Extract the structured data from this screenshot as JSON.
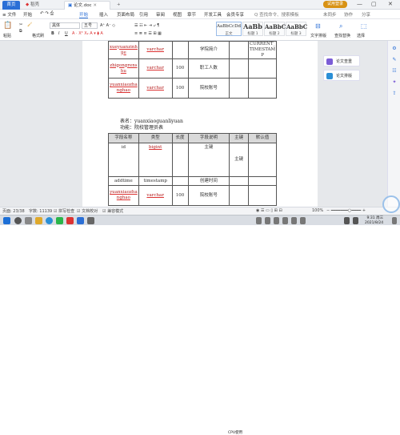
{
  "titlebar": {
    "tabs": [
      {
        "label": "首页"
      },
      {
        "label": "稻壳"
      },
      {
        "label": "论文.doc"
      }
    ],
    "add_tab": "+",
    "login": "试用登录",
    "win_min": "—",
    "win_max": "▢",
    "win_close": "✕"
  },
  "menubar": {
    "file_menu": "≡ 文件",
    "items": [
      "开始",
      "插入",
      "页面布局",
      "引用",
      "审阅",
      "视图",
      "章节",
      "开发工具",
      "会员专享"
    ],
    "search": "Q 查找命令、搜索模板",
    "cloud": "未同步",
    "collab": "协作",
    "share": "分享"
  },
  "toolbar": {
    "paste": "粘贴",
    "format_painter": "格式刷",
    "font_name": "黑体",
    "font_size": "五号",
    "bold": "B",
    "italic": "I",
    "underline": "U",
    "styles": [
      {
        "sample": "AaBbCcDd",
        "label": "正文"
      },
      {
        "sample": "AaBb",
        "label": "标题 1"
      },
      {
        "sample": "AaBbC",
        "label": "标题 2"
      },
      {
        "sample": "AaBbC",
        "label": "标题 3"
      }
    ],
    "text_layout": "文字排版",
    "find_replace": "查找替换",
    "select": "选择"
  },
  "doc": {
    "table1_rows": [
      {
        "name": "xueyuanzinhije",
        "type": "varchar",
        "len": "",
        "desc": "学院简介",
        "pk": "",
        "def": "CURRENT_TIMESTAMP"
      },
      {
        "name": "zhigongrenshu",
        "type": "varchar",
        "len": "100",
        "desc": "职工人数",
        "pk": "",
        "def": ""
      },
      {
        "name": "yuanxiaozhanghao",
        "type": "varchar",
        "len": "100",
        "desc": "院校账号",
        "pk": "",
        "def": ""
      }
    ],
    "caption_table": "表名：yuanxiaoguanliyuan",
    "caption_func": "功能：院校管理员表",
    "table2_headers": [
      "字段名称",
      "类型",
      "长度",
      "字段说明",
      "主键",
      "默认值"
    ],
    "table2_rows": [
      {
        "name": "id",
        "type": "bigint",
        "len": "",
        "desc": "主键",
        "pk": "主键",
        "def": ""
      },
      {
        "name": "addtime",
        "type": "timestamp",
        "len": "",
        "desc": "创建时间",
        "pk": "",
        "def": ""
      },
      {
        "name": "yuanxiaozhanghao",
        "type": "varchar",
        "len": "100",
        "desc": "院校账号",
        "pk": "",
        "def": ""
      }
    ]
  },
  "sidepanel": {
    "item1": "论文查重",
    "item2": "论文排版"
  },
  "statusbar": {
    "page": "页面: 23/38",
    "words": "字数: 11139",
    "spell": "拼写检查",
    "doc_check": "文档校对",
    "compat": "兼容模式",
    "zoom": "100%"
  },
  "taskbar": {
    "caption": "CPU使用",
    "time": "9:31 周三",
    "date": "2021/8/24"
  },
  "colors": {
    "accent": "#2b6fd6",
    "login": "#d89214",
    "field_red": "#b41a1a"
  }
}
